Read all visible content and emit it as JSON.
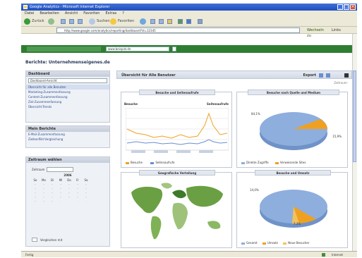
{
  "window": {
    "title": "Google Analytics - Microsoft Internet Explorer"
  },
  "menu": [
    "Datei",
    "Bearbeiten",
    "Ansicht",
    "Favoriten",
    "Extras",
    "?"
  ],
  "toolbar": {
    "back_label": "Zurück",
    "search_label": "Suchen",
    "favorites_label": "Favoriten"
  },
  "address": {
    "value": "http://www.google.com/analytics/reporting/dashboard?id=12345",
    "go_label": "Wechseln zu",
    "links_label": "Links"
  },
  "app": {
    "profile_select": "www.beispiel.de",
    "page_title": "Berichte: Unternehmenseigenes.de"
  },
  "sidebar": {
    "dashboard_head": "Dashboard",
    "dashboard_select": "Dashboard-Ansicht",
    "items": [
      "Übersicht für alle Benutzer",
      "Marketing-Zusammenfassung",
      "Content-Zusammenfassung",
      "Ziel-Zusammenfassung",
      "Übersicht-Trends"
    ],
    "report_head": "Mein Berichte",
    "reports": [
      "E-Mail-Zusammenfassung",
      "Zielkonflikt-Vergleichung"
    ],
    "calendar_head": "Zeitraum wählen",
    "calendar_select": "Zeitraum",
    "calendar_month": "2006",
    "weekdays": [
      "So",
      "Mo",
      "Di",
      "Mi",
      "Do",
      "Fr",
      "Sa"
    ],
    "compare_label": "Vergleichen mit"
  },
  "main": {
    "title": "Übersicht für Alle Benutzer",
    "export_label": "Export",
    "subtitle": "Zeitraum:"
  },
  "widgets": {
    "traffic_title": "Besuche und Seitenaufrufe",
    "traffic_left": "Besuche",
    "traffic_right": "Seitenaufrufe",
    "traffic_legend": [
      "Besuche",
      "Seitenaufrufe"
    ],
    "source_title": "Besuche nach Quelle und Medium",
    "source_legend": [
      "Direkte Zugriffe",
      "Verweisende Sites"
    ],
    "source_pct": [
      "84,1%",
      "15,9%"
    ],
    "geo_title": "Geografische Verteilung",
    "conv_title": "Besuche und Umsatz",
    "conv_pct": [
      "14,0%",
      "7,3%"
    ],
    "conv_legend": [
      "Gesamt",
      "Umsatz",
      "Neue Besucher"
    ]
  },
  "status": {
    "left": "Fertig",
    "right": "Internet"
  },
  "colors": {
    "accent": "#2f7d32",
    "pie_blue": "#8eaedd",
    "pie_orange": "#f0a020",
    "map_green": "#6aa043"
  }
}
